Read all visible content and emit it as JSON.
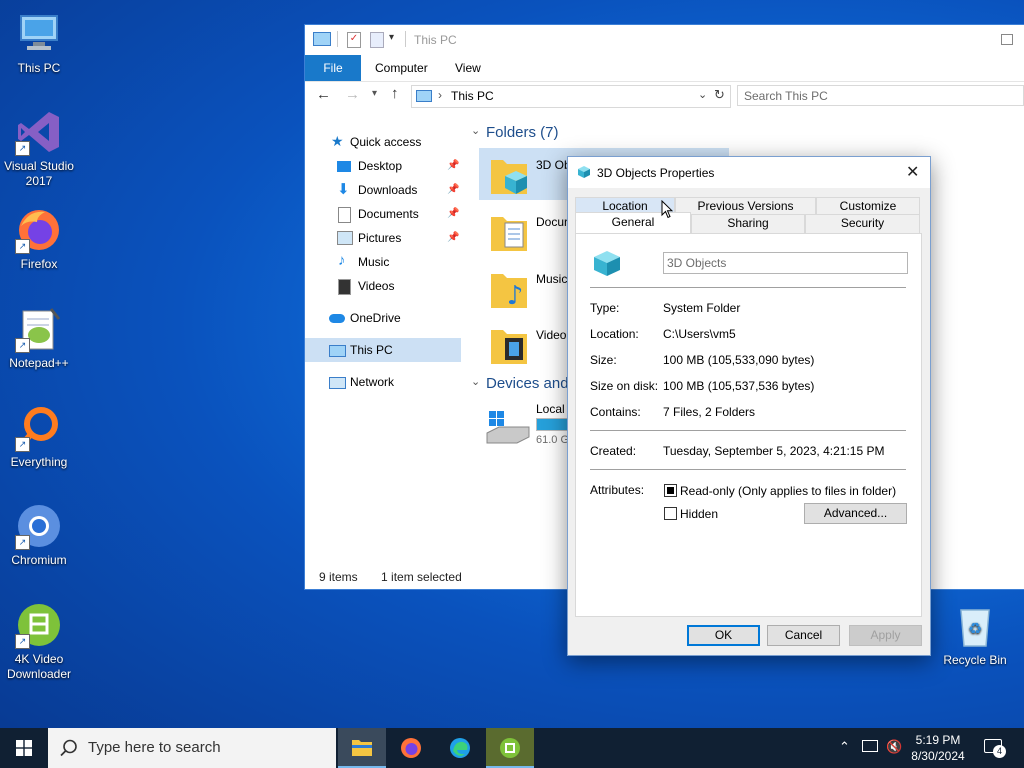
{
  "desktop": {
    "icons": [
      {
        "label": "This PC"
      },
      {
        "label": "Visual Studio 2017"
      },
      {
        "label": "Firefox"
      },
      {
        "label": "Notepad++"
      },
      {
        "label": "Everything"
      },
      {
        "label": "Chromium"
      },
      {
        "label": "4K Video Downloader"
      },
      {
        "label": "Recycle Bin"
      }
    ]
  },
  "explorer": {
    "title": "This PC",
    "ribbon_tabs": [
      "File",
      "Computer",
      "View"
    ],
    "address": "This PC",
    "search_placeholder": "Search This PC",
    "nav": {
      "quick_access": "Quick access",
      "desktop": "Desktop",
      "downloads": "Downloads",
      "documents": "Documents",
      "pictures": "Pictures",
      "music": "Music",
      "videos": "Videos",
      "onedrive": "OneDrive",
      "this_pc": "This PC",
      "network": "Network"
    },
    "folders_header": "Folders (7)",
    "devices_header": "Devices and",
    "folders": [
      "3D Ob",
      "Docur",
      "Music",
      "Video"
    ],
    "drive_label": "Local",
    "drive_free": "61.0 G",
    "status_items": "9 items",
    "status_selected": "1 item selected"
  },
  "dialog": {
    "title": "3D Objects Properties",
    "tabs_top": [
      "Location",
      "Previous Versions",
      "Customize"
    ],
    "tabs_bottom": [
      "General",
      "Sharing",
      "Security"
    ],
    "name": "3D Objects",
    "props": [
      {
        "label": "Type:",
        "value": "System Folder"
      },
      {
        "label": "Location:",
        "value": "C:\\Users\\vm5"
      },
      {
        "label": "Size:",
        "value": "100 MB (105,533,090 bytes)"
      },
      {
        "label": "Size on disk:",
        "value": "100 MB (105,537,536 bytes)"
      },
      {
        "label": "Contains:",
        "value": "7 Files, 2 Folders"
      }
    ],
    "created_label": "Created:",
    "created_value": "Tuesday, September 5, 2023, 4:21:15 PM",
    "attributes_label": "Attributes:",
    "readonly_label": "Read-only (Only applies to files in folder)",
    "hidden_label": "Hidden",
    "advanced_label": "Advanced...",
    "ok_label": "OK",
    "cancel_label": "Cancel",
    "apply_label": "Apply"
  },
  "taskbar": {
    "search_placeholder": "Type here to search",
    "time": "5:19 PM",
    "date": "8/30/2024",
    "notification_count": "4"
  },
  "colors": {
    "accent": "#0078d7",
    "file_tab": "#1979ca",
    "taskbar": "#102033",
    "folder": "#f4c542"
  }
}
